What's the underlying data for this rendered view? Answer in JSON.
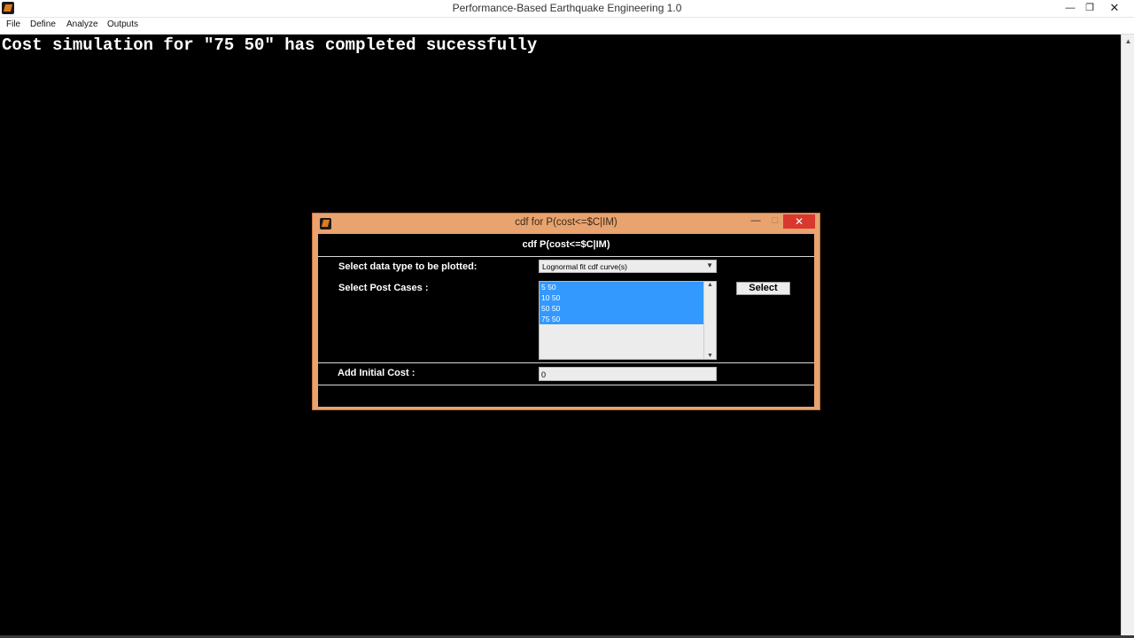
{
  "window": {
    "title": "Performance-Based Earthquake Engineering 1.0",
    "controls": {
      "minimize": "—",
      "restore": "❐",
      "close": "✕"
    }
  },
  "menu": [
    "File",
    "Define",
    "Analyze",
    "Outputs"
  ],
  "console": {
    "message": "Cost simulation for \"75 50\" has completed sucessfully"
  },
  "dialog": {
    "title": "cdf for P(cost<=$C|IM)",
    "heading": "cdf P(cost<=$C|IM)",
    "data_type_label": "Select data type to be plotted:",
    "data_type_value": "Lognormal fit cdf curve(s)",
    "post_cases_label": "Select Post Cases :",
    "post_cases": [
      "5 50",
      "10 50",
      "50 50",
      "75 50"
    ],
    "select_button": "Select",
    "initial_cost_label": "Add Initial Cost :",
    "initial_cost_value": "0",
    "controls": {
      "minimize": "—",
      "maximize": "□",
      "close": "✕"
    }
  },
  "icons": {
    "app": "matlab-icon",
    "dropdown": "chevron-down-icon",
    "scroll_up": "chevron-up-icon",
    "scroll_down": "chevron-down-icon"
  },
  "colors": {
    "console_bg": "#000000",
    "dialog_frame": "#e8a36f",
    "dialog_close": "#d9382e",
    "selection": "#3399ff"
  }
}
